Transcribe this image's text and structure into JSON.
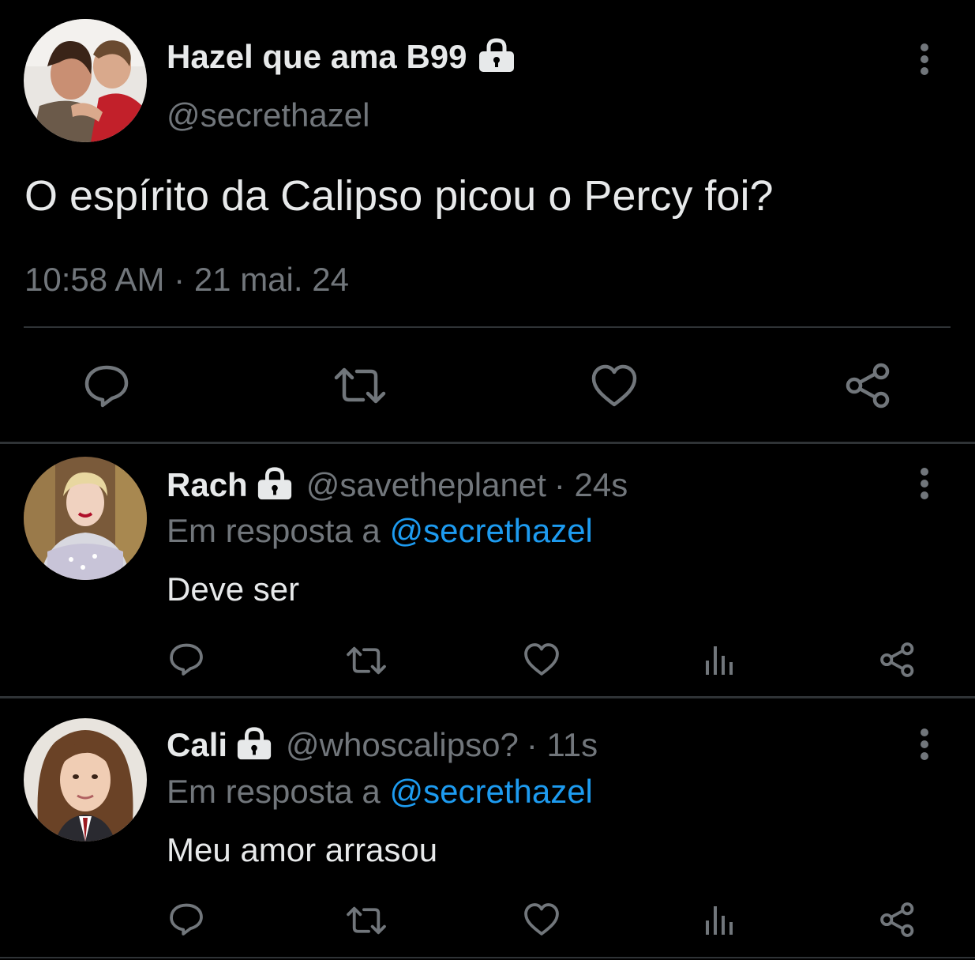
{
  "main_tweet": {
    "display_name": "Hazel que ama B99",
    "handle": "@secrethazel",
    "text": "O espírito da Calipso picou o Percy foi?",
    "time": "10:58 AM",
    "separator": "·",
    "date": "21 mai. 24"
  },
  "replies": [
    {
      "display_name": "Rach",
      "handle": "@savetheplanet",
      "age": "· 24s",
      "reply_prefix": "Em resposta a",
      "reply_to": "@secrethazel",
      "text": "Deve ser"
    },
    {
      "display_name": "Cali",
      "handle": "@whoscalipso?",
      "age": "· 11s",
      "reply_prefix": "Em resposta a",
      "reply_to": "@secrethazel",
      "text": "Meu amor arrasou"
    }
  ],
  "colors": {
    "background": "#000000",
    "text": "#e7e9ea",
    "muted": "#71767b",
    "link": "#1d9bf0",
    "divider": "#2f3336"
  },
  "icons": [
    "lock-icon",
    "more-icon",
    "reply-icon",
    "retweet-icon",
    "like-icon",
    "share-icon",
    "views-icon"
  ]
}
